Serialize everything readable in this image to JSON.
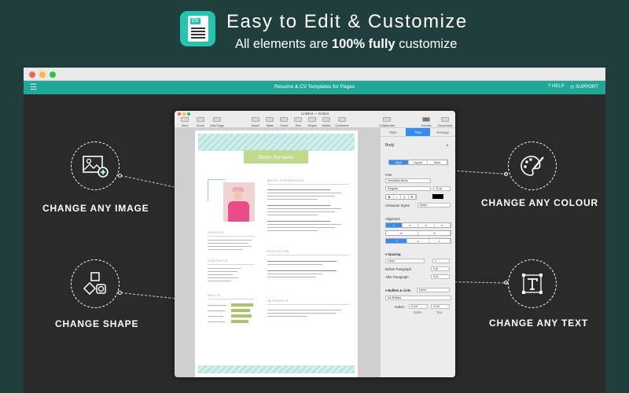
{
  "header": {
    "icon_label": "CV",
    "title": "Easy to Edit & Customize",
    "subtitle_pre": "All elements are ",
    "subtitle_bold": "100% fully",
    "subtitle_post": " customize"
  },
  "app_window": {
    "menu_icon": "hamburger-icon",
    "title": "Resume & CV Templates for Pages",
    "help_label": "HELP",
    "support_label": "SUPPORT",
    "help_icon": "question-icon",
    "support_icon": "lifebuoy-icon"
  },
  "callouts": [
    {
      "id": "image",
      "label": "CHANGE ANY IMAGE",
      "icon": "image-add-icon"
    },
    {
      "id": "shape",
      "label": "CHANGE SHAPE",
      "icon": "shapes-icon"
    },
    {
      "id": "colour",
      "label": "CHANGE ANY COLOUR",
      "icon": "palette-icon"
    },
    {
      "id": "text",
      "label": "CHANGE ANY TEXT",
      "icon": "text-frame-icon"
    }
  ],
  "pages": {
    "doc_title": "Untitled — Edited",
    "zoom": "100%",
    "toolbar": [
      "View",
      "Zoom",
      "Add Page",
      "Insert",
      "Table",
      "Chart",
      "Text",
      "Shape",
      "Media",
      "Comment",
      "Collaborate",
      "Format",
      "Document"
    ],
    "inspector_tabs": [
      "Style",
      "Text",
      "Arrange"
    ],
    "paragraph_style": "Body",
    "sub_tabs": [
      "Style",
      "Layout",
      "More"
    ],
    "font_label": "Font",
    "font_name": "Helvetica Neue",
    "font_weight": "Regular",
    "font_size": "11 pt",
    "char_styles_label": "Character Styles",
    "char_styles_value": "None",
    "alignment_label": "Alignment",
    "spacing_label": "Spacing",
    "spacing_mode": "Lines",
    "spacing_value": "1",
    "before_label": "Before Paragraph",
    "before_value": "0 pt",
    "after_label": "After Paragraph",
    "after_value": "0 pt",
    "bullets_label": "Bullets & Lists",
    "bullets_value": "None",
    "no_bullets": "No Bullets",
    "indent_label": "Indent:",
    "indent_bullet": "0 cm",
    "indent_text": "0 cm",
    "bullet_label": "Bullet",
    "text_label": "Text"
  },
  "resume": {
    "name": "Name Surname",
    "sections": [
      "WORK EXPERIENCE",
      "EDUCATION",
      "INTERESTS",
      "PROFILE",
      "CONTACTS",
      "SKILLS"
    ]
  },
  "colors": {
    "background": "#1f3e3c",
    "accent": "#1fa896",
    "icon_bg": "#22c5ae",
    "name_box": "#c0d98c",
    "inspector_blue": "#2f8df7"
  }
}
